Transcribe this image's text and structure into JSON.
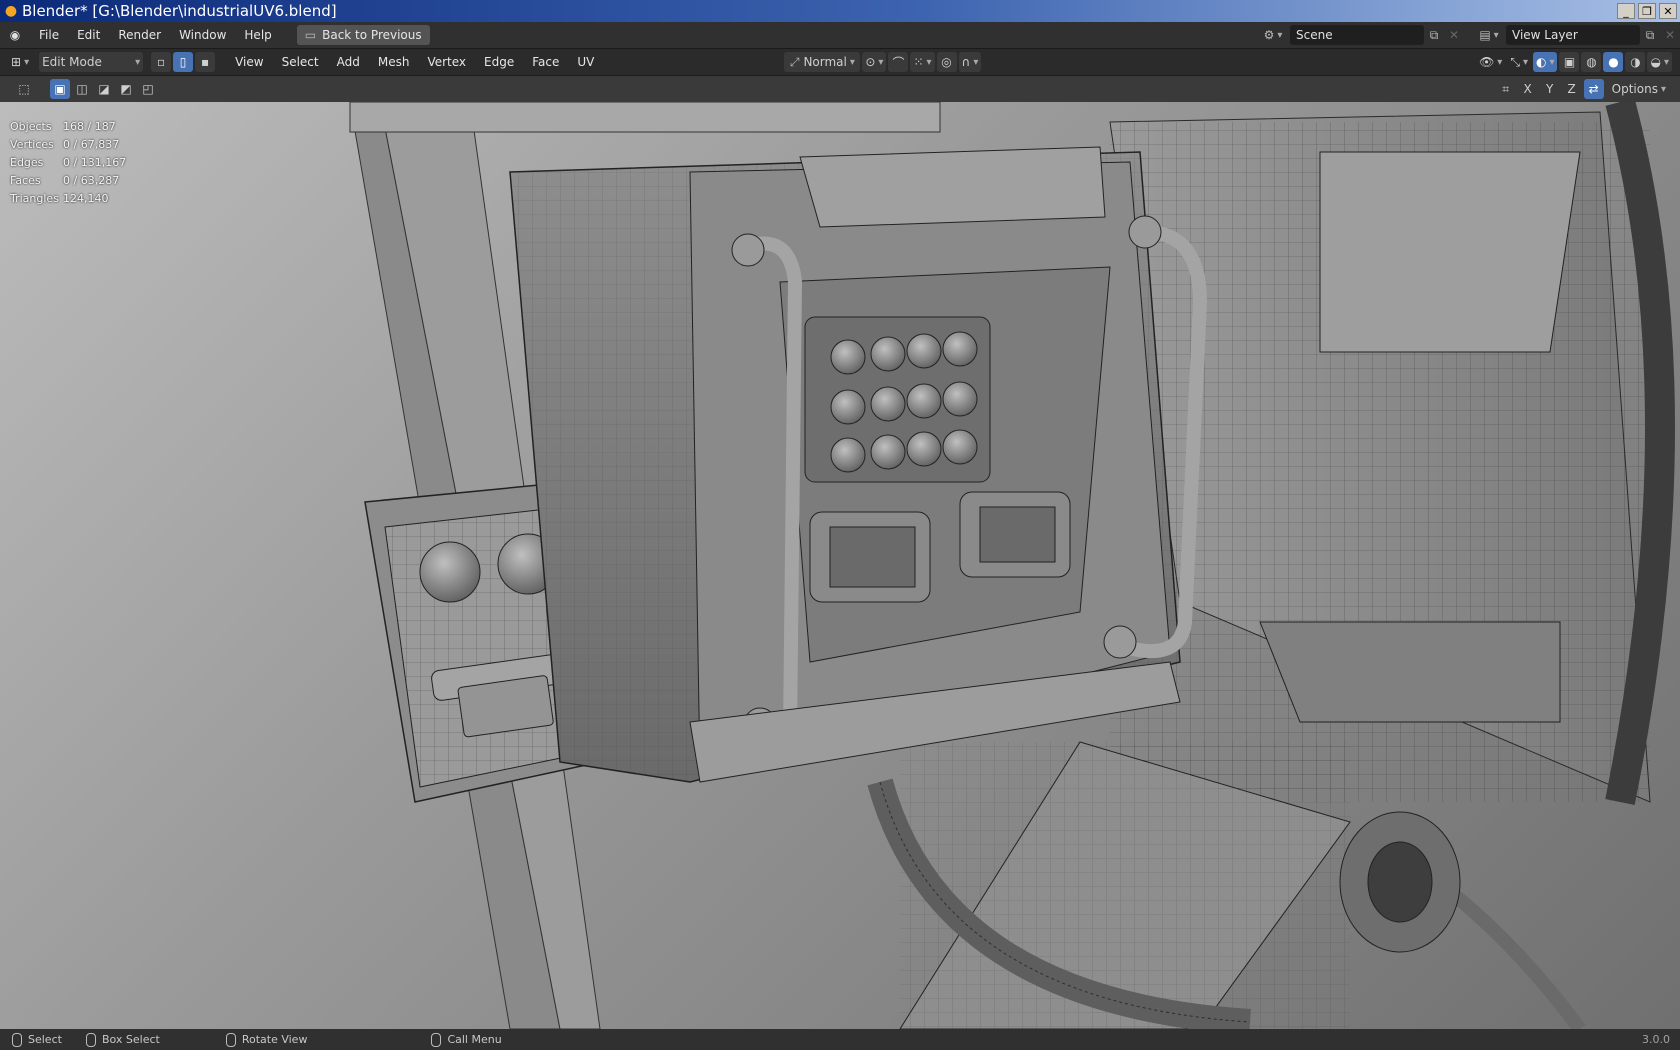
{
  "window": {
    "title": "Blender* [G:\\Blender\\industrialUV6.blend]",
    "minimize": "_",
    "restore": "❐",
    "close": "✕"
  },
  "menubar": {
    "items": [
      "File",
      "Edit",
      "Render",
      "Window",
      "Help"
    ],
    "back_button": "Back to Previous",
    "scene": "Scene",
    "view_layer": "View Layer"
  },
  "header": {
    "mode": "Edit Mode",
    "menus": [
      "View",
      "Select",
      "Add",
      "Mesh",
      "Vertex",
      "Edge",
      "Face",
      "UV"
    ],
    "orientation": "Normal",
    "axes": [
      "X",
      "Y",
      "Z"
    ],
    "options": "Options"
  },
  "stats": [
    {
      "label": "Objects",
      "value": "168 / 187"
    },
    {
      "label": "Vertices",
      "value": "0 / 67,837"
    },
    {
      "label": "Edges",
      "value": "0 / 131,167"
    },
    {
      "label": "Faces",
      "value": "0 / 63,287"
    },
    {
      "label": "Triangles",
      "value": "124,140"
    }
  ],
  "statusbar": {
    "select": "Select",
    "box_select": "Box Select",
    "rotate_view": "Rotate View",
    "call_menu": "Call Menu",
    "version": "3.0.0"
  }
}
